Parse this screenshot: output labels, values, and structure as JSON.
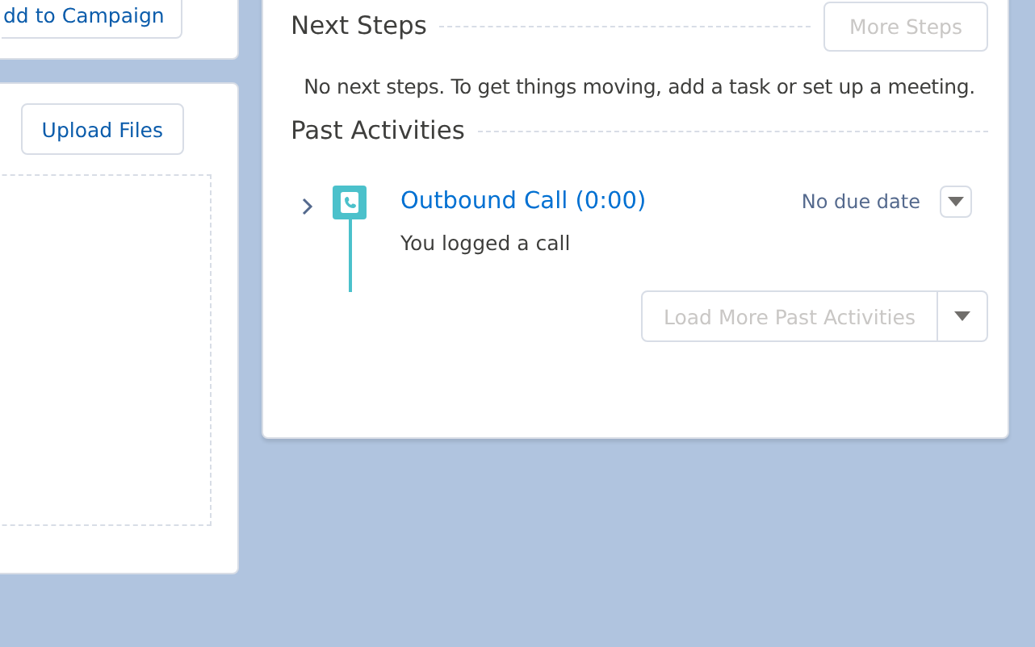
{
  "left_panel": {
    "campaign_button": {
      "label": "dd to Campaign"
    },
    "files_card": {
      "upload_button": {
        "label": "Upload Files"
      }
    }
  },
  "activity_panel": {
    "next_steps": {
      "title": "Next Steps",
      "more_button": {
        "label": "More Steps",
        "disabled": true
      },
      "empty_message": "No next steps. To get things moving, add a task or set up a meeting."
    },
    "past_activities": {
      "title": "Past Activities",
      "items": [
        {
          "kind": "call",
          "title": "Outbound Call (0:00)",
          "due": "No due date",
          "summary": "You logged a call",
          "expanded": false
        }
      ],
      "load_more_button": {
        "label": "Load More Past Activities",
        "disabled": true
      }
    }
  }
}
